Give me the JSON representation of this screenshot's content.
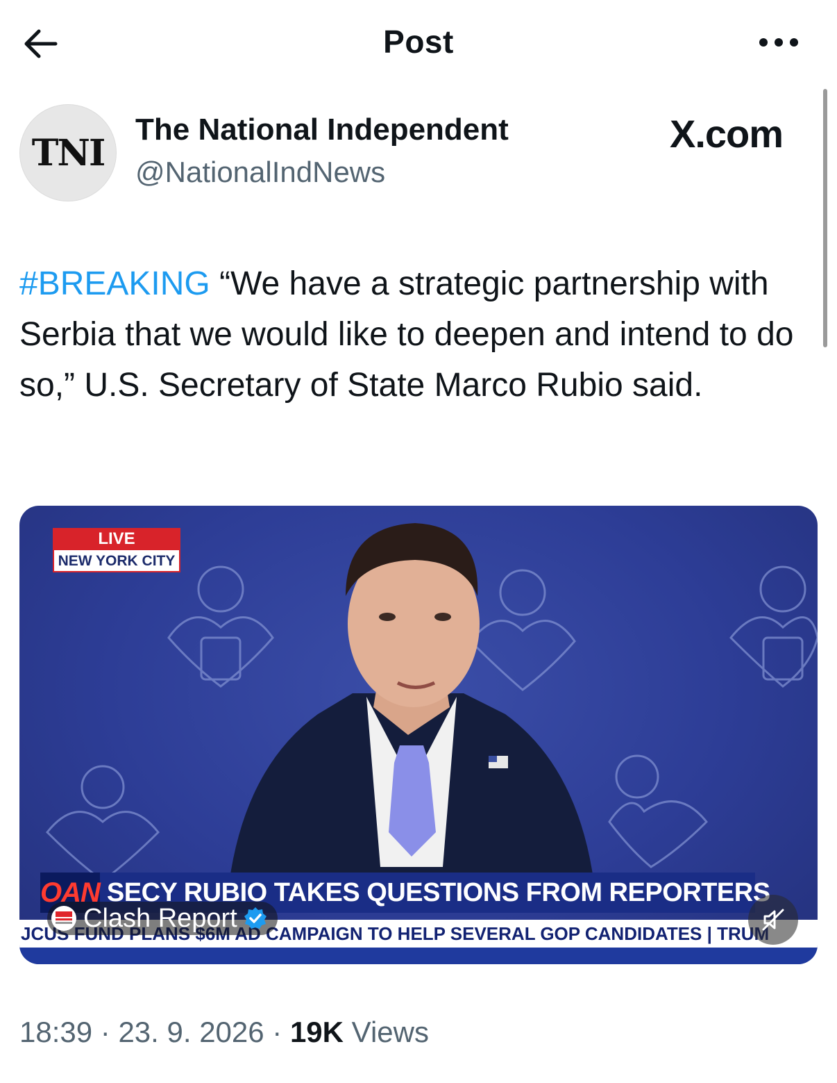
{
  "header": {
    "title": "Post",
    "back_icon": "arrow-left-icon",
    "more_icon": "more-horizontal-icon"
  },
  "author": {
    "avatar_text": "TNI",
    "name": "The National Independent",
    "handle": "@NationalIndNews"
  },
  "brand_mark": "X.com",
  "tweet": {
    "hashtag": "#BREAKING",
    "text": " “We have a strategic partnership with Serbia that we would like to deepen and intend to do so,” U.S. Secretary of State Marco Rubio said."
  },
  "media": {
    "live_label": "LIVE",
    "location": "NEW YORK CITY",
    "network_logo": "OAN",
    "headline": "SECY RUBIO TAKES QUESTIONS FROM REPORTERS",
    "ticker": "JCUS FUND PLANS $6M AD CAMPAIGN TO HELP SEVERAL GOP CANDIDATES  |  TRUM",
    "source_name": "Clash Report",
    "mute_icon": "speaker-muted-icon",
    "verified_icon": "verified-badge-icon"
  },
  "meta": {
    "time": "18:39",
    "separator": " · ",
    "date": "23. 9. 2026",
    "views_count": "19K",
    "views_label": " Views"
  },
  "colors": {
    "link": "#1d9bf0",
    "secondary_text": "#536471",
    "media_background": "#2d3d96"
  }
}
